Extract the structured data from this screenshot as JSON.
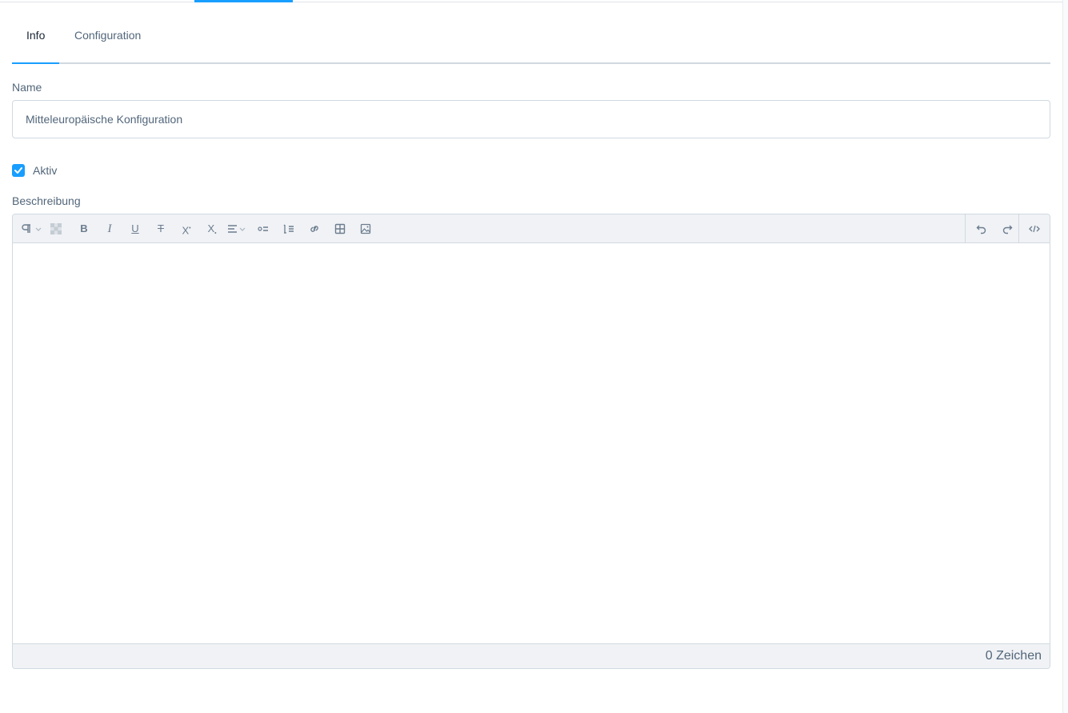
{
  "tabs": [
    {
      "label": "Info",
      "active": true
    },
    {
      "label": "Configuration",
      "active": false
    }
  ],
  "form": {
    "name_label": "Name",
    "name_value": "Mitteleuropäische Konfiguration",
    "active_label": "Aktiv",
    "active_checked": true,
    "description_label": "Beschreibung"
  },
  "editor": {
    "toolbar_left": [
      "paragraph-format-icon",
      "text-color-icon",
      "bold-icon",
      "italic-icon",
      "underline-icon",
      "strikethrough-icon",
      "superscript-icon",
      "subscript-icon",
      "align-icon",
      "bullet-list-icon",
      "numbered-list-icon",
      "link-icon",
      "table-icon",
      "image-icon"
    ],
    "toolbar_right": [
      "undo-icon",
      "redo-icon",
      "code-view-icon"
    ],
    "content": "",
    "char_count": "0 Zeichen"
  },
  "colors": {
    "accent": "#189eff",
    "text": "#52667a",
    "border": "#d1d9e0",
    "toolbar_bg": "#f0f2f5"
  }
}
